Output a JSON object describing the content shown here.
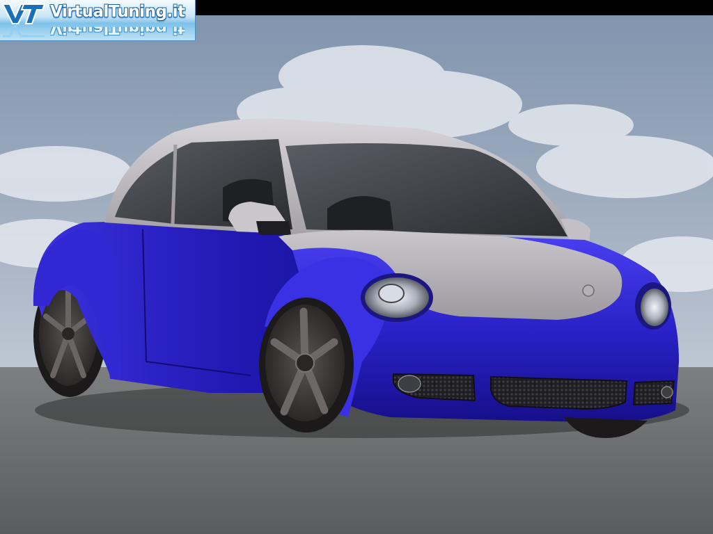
{
  "watermark": {
    "text": "VirtualTuning.it",
    "mark_colors": [
      "#1a6fb8",
      "#8fd0f4"
    ]
  },
  "scene": {
    "subject": "car",
    "colors": {
      "body": "#2a22c8",
      "roof": "#b7b4b8",
      "sky_top": "#7f93ad",
      "sky_bottom": "#c2cad5",
      "road": "#6b6d6d",
      "wheels": "#3e3838"
    }
  }
}
